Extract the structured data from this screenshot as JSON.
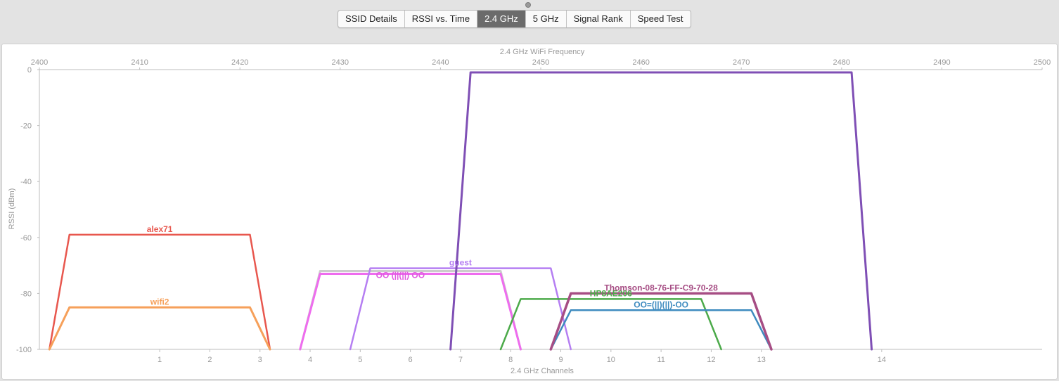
{
  "tabs": [
    {
      "label": "SSID Details",
      "active": false
    },
    {
      "label": "RSSI vs. Time",
      "active": false
    },
    {
      "label": "2.4 GHz",
      "active": true
    },
    {
      "label": "5 GHz",
      "active": false
    },
    {
      "label": "Signal Rank",
      "active": false
    },
    {
      "label": "Speed Test",
      "active": false
    }
  ],
  "chart_data": {
    "type": "area",
    "top_axis_label": "2.4 GHz WiFi Frequency",
    "xlabel": "2.4 GHz Channels",
    "ylabel": "RSSI (dBm)",
    "xlim_mhz": [
      2400,
      2500
    ],
    "ylim": [
      -100,
      0
    ],
    "freq_ticks": [
      2400,
      2410,
      2420,
      2430,
      2440,
      2450,
      2460,
      2470,
      2480,
      2490,
      2500
    ],
    "rssi_ticks": [
      0,
      -20,
      -40,
      -60,
      -80,
      -100
    ],
    "channel_ticks": [
      1,
      2,
      3,
      4,
      5,
      6,
      7,
      8,
      9,
      10,
      11,
      12,
      13,
      14
    ],
    "grid": false,
    "series": [
      {
        "name": "alex71",
        "color": "#e8574e",
        "width": 2.5,
        "rssi": -59,
        "start_mhz": 2401,
        "ramp_end_mhz": 2403,
        "flat_end_mhz": 2421,
        "end_mhz": 2423
      },
      {
        "name": "wifi2",
        "color": "#f6a05a",
        "width": 3,
        "rssi": -85,
        "start_mhz": 2401,
        "ramp_end_mhz": 2403,
        "flat_end_mhz": 2421,
        "end_mhz": 2423
      },
      {
        "name": "",
        "color": "#cccccc",
        "width": 3,
        "rssi": -72,
        "start_mhz": 2426,
        "ramp_end_mhz": 2428,
        "flat_end_mhz": 2446,
        "end_mhz": 2448
      },
      {
        "name": "",
        "color": "#ee6cee",
        "width": 3,
        "rssi": -73,
        "start_mhz": 2426,
        "ramp_end_mhz": 2428,
        "flat_end_mhz": 2446,
        "end_mhz": 2448
      },
      {
        "name": "guest",
        "color": "#b57ef2",
        "width": 2.5,
        "rssi": -71,
        "start_mhz": 2431,
        "ramp_end_mhz": 2433,
        "flat_end_mhz": 2451,
        "end_mhz": 2453
      },
      {
        "name": "",
        "color": "#7f4fb5",
        "width": 3,
        "rssi": -1,
        "start_mhz": 2441,
        "ramp_end_mhz": 2443,
        "flat_end_mhz": 2481,
        "end_mhz": 2483
      },
      {
        "name": "HP8AE206",
        "color": "#4caa4a",
        "width": 2.5,
        "rssi": -82,
        "start_mhz": 2446,
        "ramp_end_mhz": 2448,
        "flat_end_mhz": 2466,
        "end_mhz": 2468
      },
      {
        "name": "OO=(||)(||)-OO",
        "color": "#3e8bbf",
        "width": 2.5,
        "rssi": -86,
        "start_mhz": 2451,
        "ramp_end_mhz": 2453,
        "flat_end_mhz": 2471,
        "end_mhz": 2473
      },
      {
        "name": "Thomson-08-76-FF-C9-70-28",
        "color": "#a64d84",
        "width": 3.5,
        "rssi": -80,
        "start_mhz": 2451,
        "ramp_end_mhz": 2453,
        "flat_end_mhz": 2471,
        "end_mhz": 2473
      }
    ],
    "annotations": [
      {
        "text": "OO (||(||) OO",
        "color": "#e05be0",
        "mhz": 2436,
        "rssi": -72
      }
    ]
  }
}
